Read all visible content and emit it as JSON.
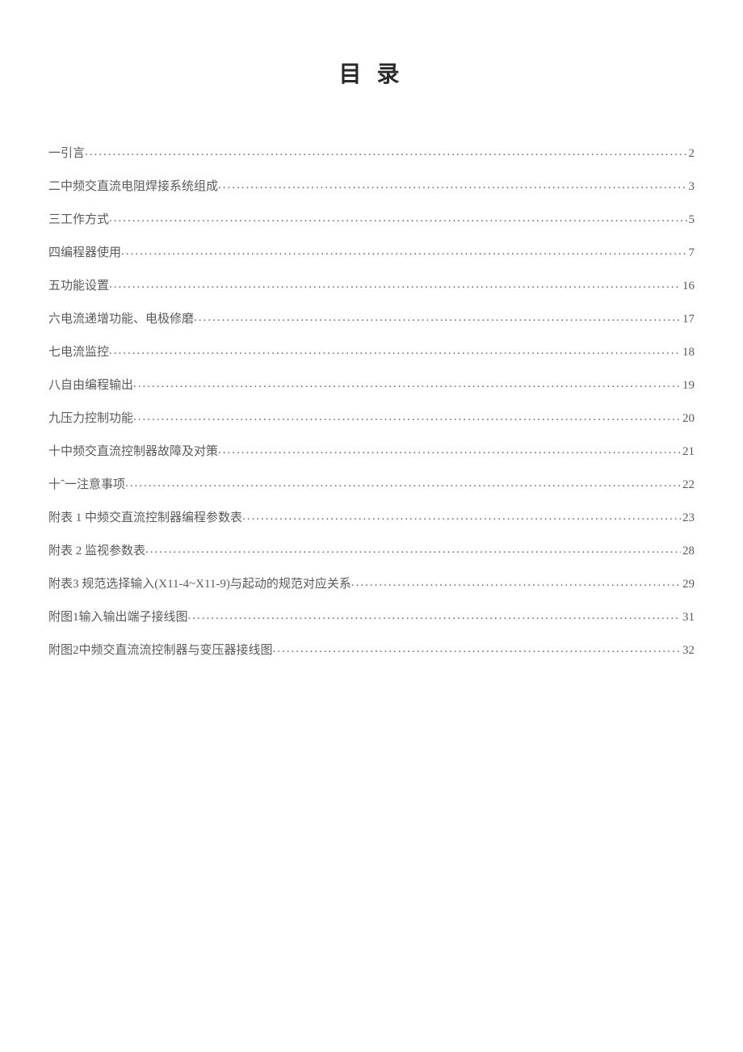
{
  "title": "目 录",
  "toc": [
    {
      "label": "一引言",
      "page": "2"
    },
    {
      "label": "二中频交直流电阻焊接系统组成",
      "page": "3"
    },
    {
      "label": "三工作方式",
      "page": "5"
    },
    {
      "label": "四编程器使用",
      "page": "7"
    },
    {
      "label": "五功能设置",
      "page": "16"
    },
    {
      "label": "六电流递增功能、电极修磨",
      "page": "17"
    },
    {
      "label": "七电流监控",
      "page": "18"
    },
    {
      "label": "八自由编程输出",
      "page": "19"
    },
    {
      "label": "九压力控制功能",
      "page": "20"
    },
    {
      "label": "十中频交直流控制器故障及对策",
      "page": "21"
    },
    {
      "label": "十ˆ一注意事项",
      "page": "22"
    },
    {
      "label": "附表 1 中频交直流控制器编程参数表 ",
      "page": "23"
    },
    {
      "label": "附表 2 监视参数表",
      "page": "28"
    },
    {
      "label": "附表3 规范选择输入(X11-4~X11-9)与起动的规范对应关系",
      "page": "29"
    },
    {
      "label": "附图1输入输出端子接线图",
      "page": "31"
    },
    {
      "label": "附图2中频交直流流控制器与变压器接线图",
      "page": "32"
    }
  ]
}
